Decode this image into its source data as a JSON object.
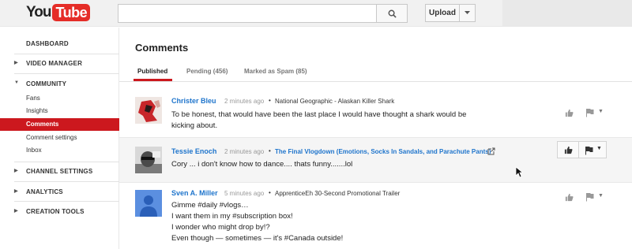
{
  "logo": {
    "you": "You",
    "tube": "Tube"
  },
  "search": {
    "placeholder": ""
  },
  "toolbar": {
    "upload_label": "Upload"
  },
  "sidebar": {
    "sections": [
      {
        "label": "DASHBOARD"
      },
      {
        "label": "VIDEO MANAGER"
      },
      {
        "label": "COMMUNITY"
      },
      {
        "label": "CHANNEL SETTINGS"
      },
      {
        "label": "ANALYTICS"
      },
      {
        "label": "CREATION TOOLS"
      }
    ],
    "community_items": [
      {
        "label": "Fans"
      },
      {
        "label": "Insights"
      },
      {
        "label": "Comments"
      },
      {
        "label": "Comment settings"
      },
      {
        "label": "Inbox"
      }
    ]
  },
  "page": {
    "title": "Comments"
  },
  "tabs": [
    {
      "label": "Published"
    },
    {
      "label": "Pending (456)"
    },
    {
      "label": "Marked as Spam (85)"
    }
  ],
  "comments": [
    {
      "author": "Christer Bleu",
      "time": "2 minutes ago",
      "bullet": "•",
      "video": "National Geographic - Alaskan Killer Shark",
      "lines": [
        "To be honest, that would have been the last place I would have thought a shark would be",
        "kicking about."
      ]
    },
    {
      "author": "Tessie Enoch",
      "time": "2 minutes ago",
      "bullet": "•",
      "video": "The Final Vlogdown (Emotions, Socks In Sandals, and Parachute Pants)",
      "lines": [
        "Cory ... i don't know how to dance.... thats funny.......lol"
      ]
    },
    {
      "author": "Sven A. Miller",
      "time": "5 minutes ago",
      "bullet": "•",
      "video": "ApprenticeEh 30-Second Promotional Trailer",
      "lines": [
        "Gimme #daily #vlogs…",
        "I want them in my #subscription box!",
        "I wonder who might drop by!?",
        "Even though — sometimes — it's #Canada outside!"
      ]
    }
  ],
  "colors": {
    "accent": "#cc181e",
    "link": "#1f75cc"
  }
}
